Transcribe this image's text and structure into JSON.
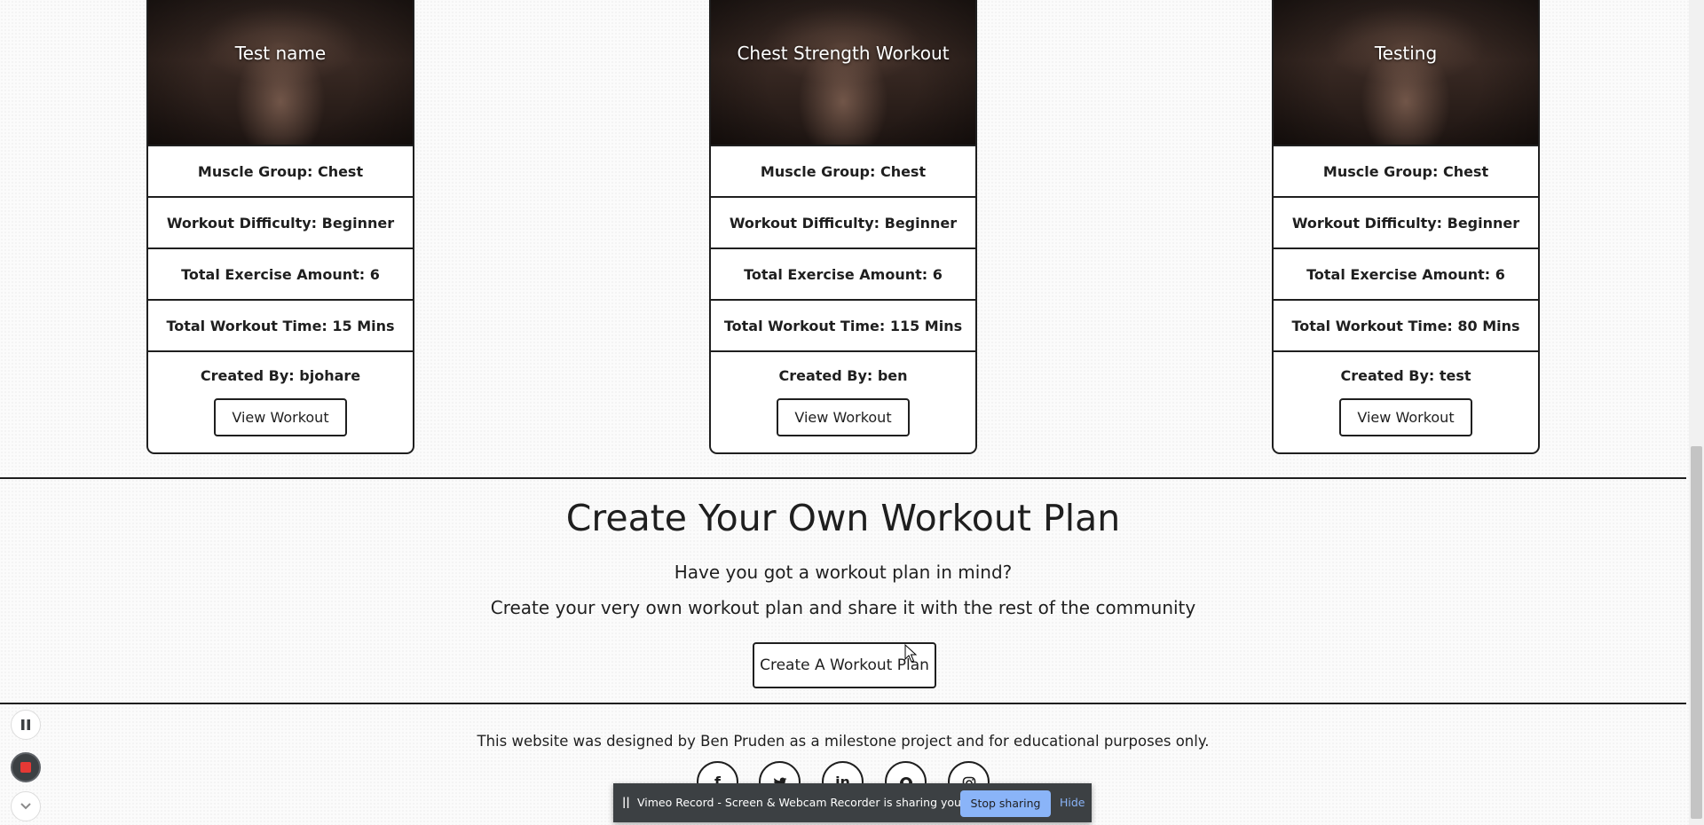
{
  "workouts": [
    {
      "title": "Test name",
      "muscle_group": "Muscle Group: Chest",
      "difficulty": "Workout Difficulty: Beginner",
      "exercise_amount": "Total Exercise Amount: 6",
      "workout_time": "Total Workout Time: 15 Mins",
      "created_by": "Created By: bjohare",
      "button_label": "View Workout"
    },
    {
      "title": "Chest Strength Workout",
      "muscle_group": "Muscle Group: Chest",
      "difficulty": "Workout Difficulty: Beginner",
      "exercise_amount": "Total Exercise Amount: 6",
      "workout_time": "Total Workout Time: 115 Mins",
      "created_by": "Created By: ben",
      "button_label": "View Workout"
    },
    {
      "title": "Testing",
      "muscle_group": "Muscle Group: Chest",
      "difficulty": "Workout Difficulty: Beginner",
      "exercise_amount": "Total Exercise Amount: 6",
      "workout_time": "Total Workout Time: 80 Mins",
      "created_by": "Created By: test",
      "button_label": "View Workout"
    }
  ],
  "create_section": {
    "title": "Create Your Own Workout Plan",
    "subtitle": "Have you got a workout plan in mind?",
    "description": "Create your very own workout plan and share it with the rest of the community",
    "button_label": "Create A Workout Plan"
  },
  "footer": {
    "text": "This website was designed by Ben Pruden as a milestone project and for educational purposes only.",
    "social_icons": [
      "facebook-icon",
      "twitter-icon",
      "linkedin-icon",
      "github-icon",
      "instagram-icon"
    ]
  },
  "screen_share_bar": {
    "message": "Vimeo Record - Screen & Webcam Recorder is sharing your screen.",
    "stop_label": "Stop sharing",
    "hide_label": "Hide"
  },
  "recorder_controls": [
    "pause-icon",
    "stop-record-icon",
    "chevron-down-icon"
  ],
  "colors": {
    "border": "#1f1f1f",
    "page_background": "#fbfbfb",
    "share_bar_background": "#3c4043",
    "share_bar_accent": "#8ab4f8",
    "record_red": "#e53935"
  }
}
